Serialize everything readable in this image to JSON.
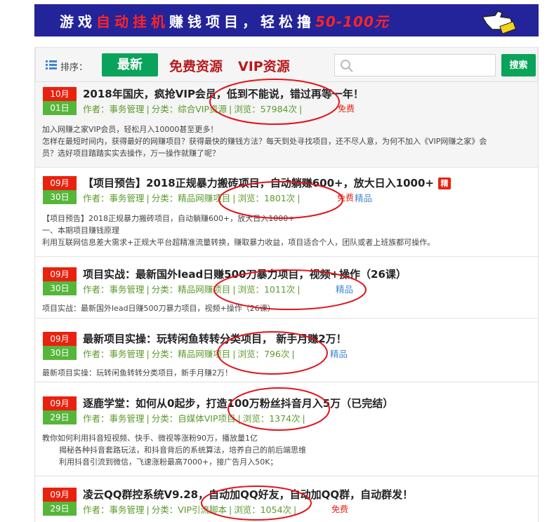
{
  "banner": {
    "part1": "游戏",
    "part2": "自动挂机",
    "part3": "赚钱项目，轻松撸",
    "part4": "50-100元"
  },
  "sortbar": {
    "label": "排序：",
    "tab_newest": "最新",
    "tab_free": "免费资源",
    "tab_vip": "VIP资源",
    "search_placeholder": "",
    "search_button": "搜索"
  },
  "colors": {
    "accent_green": "#0aa35a",
    "accent_red": "#b9191d",
    "month_red": "#e8220f",
    "day_green": "#56b63a",
    "annotation_red": "#e3131b"
  },
  "articles": [
    {
      "month": "10月",
      "day": "01日",
      "title": "2018年国庆，疯抢VIP会员，低到不能说，错过再等一年！",
      "author": "作者：事务管理",
      "category": "分类：综合VIP资源",
      "views": "浏览：57984次",
      "tag": "免费",
      "summary": [
        "加入网赚之家VIP会员，轻松月入10000甚至更多！",
        "怎样在最短时间内，获得最好的网赚项目？获得最快的赚钱方法？每天到处寻找项目，还不尽人意，为何不加入《VIP网赚之家》会",
        "员？选好项目踏踏实实去操作，万一操作就赚了呢？"
      ]
    },
    {
      "month": "09月",
      "day": "30日",
      "title": "【项目预告】2018正规暴力搬砖项目，自动躺赚600+，放大日入1000+",
      "badge": "精",
      "author": "作者：事务管理",
      "category": "分类：精品网赚项目",
      "views": "浏览：1801次",
      "tag": "免费",
      "tag2": "精品",
      "summary": [
        "【项目预告】2018正规暴力搬砖项目，自动躺赚600+，放大日入1000+",
        "一、本期项目赚钱原理",
        "利用互联网信息差大需求+正规大平台超精准流量转换，赚取暴力收益，项目适合个人，团队或者上班族都可操作。"
      ]
    },
    {
      "month": "09月",
      "day": "30日",
      "title": "项目实战：最新国外lead日赚500刀暴力项目，视频+操作（26课）",
      "author": "作者：事务管理",
      "category": "分类：精品网赚项目",
      "views": "浏览：1011次",
      "tag2": "精品",
      "summary": [
        "项目实战：最新国外lead日赚500刀暴力项目，视频+操作（26课）"
      ]
    },
    {
      "month": "09月",
      "day": "30日",
      "title": "最新项目实操：玩转闲鱼转转分类项目， 新手月赚2万！",
      "author": "作者：事务管理",
      "category": "分类：精品网赚项目",
      "views": "浏览：796次",
      "tag2": "精品",
      "summary": [
        "最新项目实操：玩转闲鱼转转分类项目，新手月赚2万！"
      ]
    },
    {
      "month": "09月",
      "day": "29日",
      "title": "逐鹿学堂：如何从0起步，打造100万粉丝抖音月入5万（已完结）",
      "author": "作者：事务管理",
      "category": "分类：自媒体VIP项目",
      "views": "浏览：1374次",
      "summary": [
        "教你如何利用抖音短视频、快手、微视等涨粉90万，播放量1亿",
        "揭秘各种抖音套路玩法，和抖音背后的系统算法，培养自己的前后端思维",
        "利用抖音引流到微信，飞速涨粉最高7000+，接广告月入50K；"
      ]
    },
    {
      "month": "09月",
      "day": "29日",
      "title": "凌云QQ群控系统V9.28，自动加QQ好友，自动加QQ群，自动群发！",
      "author": "作者：事务管理",
      "category": "分类：VIP引流脚本",
      "views": "浏览：1054次",
      "tag": "免费"
    }
  ]
}
